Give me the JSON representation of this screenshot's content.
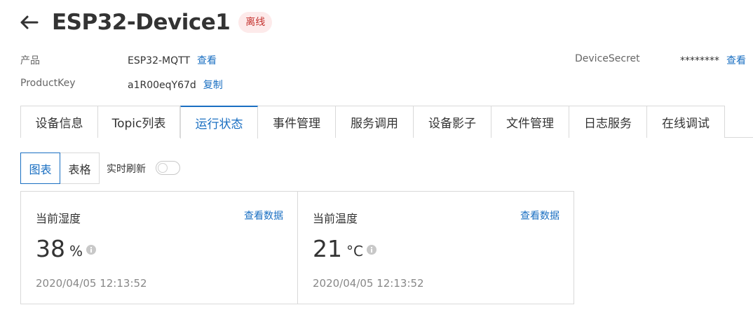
{
  "header": {
    "title": "ESP32-Device1",
    "status": "离线"
  },
  "info": {
    "product_label": "产品",
    "product_value": "ESP32-MQTT",
    "product_link": "查看",
    "productkey_label": "ProductKey",
    "productkey_value": "a1R00eqY67d",
    "productkey_link": "复制",
    "secret_label": "DeviceSecret",
    "secret_value": "********",
    "secret_link": "查看"
  },
  "tabs": [
    {
      "label": "设备信息"
    },
    {
      "label": "Topic列表"
    },
    {
      "label": "运行状态"
    },
    {
      "label": "事件管理"
    },
    {
      "label": "服务调用"
    },
    {
      "label": "设备影子"
    },
    {
      "label": "文件管理"
    },
    {
      "label": "日志服务"
    },
    {
      "label": "在线调试"
    }
  ],
  "active_tab": "运行状态",
  "view": {
    "chart_label": "图表",
    "table_label": "表格",
    "refresh_label": "实时刷新",
    "refresh_on": false
  },
  "cards": [
    {
      "title": "当前湿度",
      "link": "查看数据",
      "value": "38",
      "unit": "%",
      "time": "2020/04/05 12:13:52"
    },
    {
      "title": "当前温度",
      "link": "查看数据",
      "value": "21",
      "unit": "°C",
      "time": "2020/04/05 12:13:52"
    }
  ],
  "colors": {
    "accent": "#1a6fc2",
    "offline_bg": "#fdeaea",
    "offline_text": "#c4332f"
  },
  "icons": {
    "back": "arrow-left-icon",
    "info": "info-circle-icon"
  }
}
